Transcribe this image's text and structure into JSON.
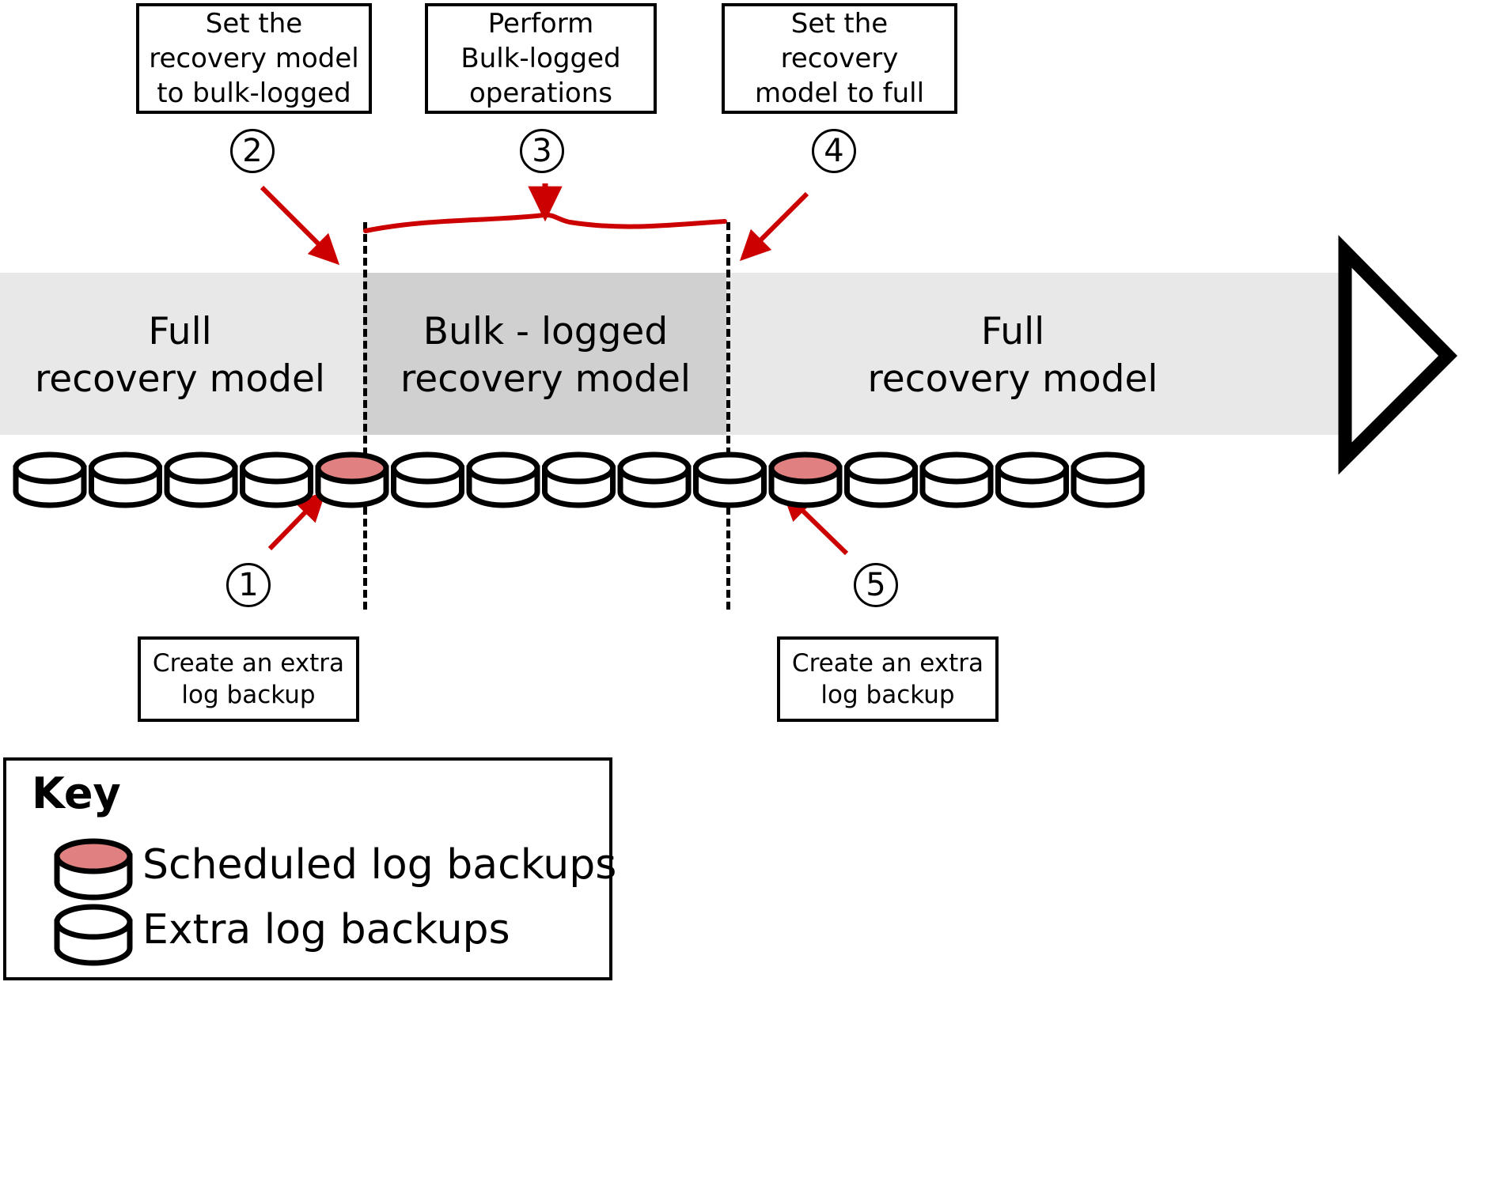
{
  "diagram": {
    "title_hidden": "",
    "colors": {
      "scheduled_backup_fill": "#e08080",
      "full_band": "#e8e8e8",
      "bulk_band": "#d0d0d0",
      "arrow": "#cc0000",
      "outline": "#000000"
    }
  },
  "callouts": [
    {
      "id": "step2",
      "text": "Set the\nrecovery model\nto bulk-logged"
    },
    {
      "id": "step3",
      "text": "Perform\nBulk-logged\noperations"
    },
    {
      "id": "step4",
      "text": "Set the\nrecovery\nmodel to full"
    },
    {
      "id": "step1",
      "text": "Create an extra\nlog backup"
    },
    {
      "id": "step5",
      "text": "Create an extra\nlog backup"
    }
  ],
  "step_numbers": {
    "one": "1",
    "two": "2",
    "three": "3",
    "four": "4",
    "five": "5"
  },
  "timeline": {
    "segments": [
      {
        "id": "full-left",
        "label": "Full\nrecovery model",
        "model": "full"
      },
      {
        "id": "bulk-middle",
        "label": "Bulk - logged\nrecovery model",
        "model": "bulk-logged"
      },
      {
        "id": "full-right",
        "label": "Full\nrecovery model",
        "model": "full"
      }
    ],
    "backups": [
      {
        "index": 1,
        "type": "extra"
      },
      {
        "index": 2,
        "type": "extra"
      },
      {
        "index": 3,
        "type": "extra"
      },
      {
        "index": 4,
        "type": "extra"
      },
      {
        "index": 5,
        "type": "scheduled"
      },
      {
        "index": 6,
        "type": "extra"
      },
      {
        "index": 7,
        "type": "extra"
      },
      {
        "index": 8,
        "type": "extra"
      },
      {
        "index": 9,
        "type": "extra"
      },
      {
        "index": 10,
        "type": "extra"
      },
      {
        "index": 11,
        "type": "scheduled"
      },
      {
        "index": 12,
        "type": "extra"
      },
      {
        "index": 13,
        "type": "extra"
      },
      {
        "index": 14,
        "type": "extra"
      },
      {
        "index": 15,
        "type": "extra"
      }
    ]
  },
  "key": {
    "title": "Key",
    "items": [
      {
        "swatch": "scheduled",
        "label": "Scheduled log backups"
      },
      {
        "swatch": "extra",
        "label": "Extra log backups"
      }
    ]
  }
}
